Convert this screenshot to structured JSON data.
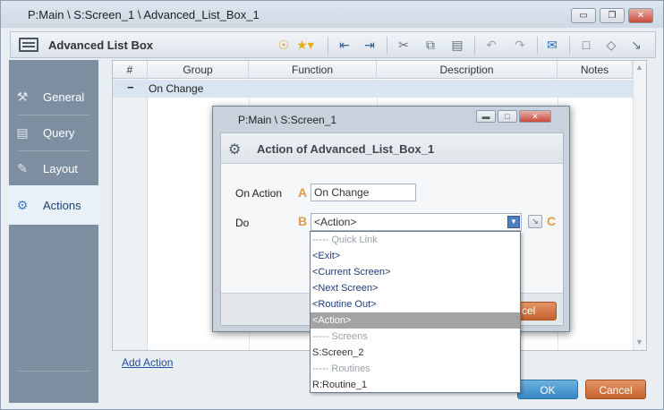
{
  "window": {
    "title": "P:Main \\ S:Screen_1 \\ Advanced_List_Box_1",
    "minimize": "▭",
    "maximize": "❐",
    "close": "✕"
  },
  "toolbar": {
    "title": "Advanced List Box",
    "icons": [
      "bulb-icon",
      "star-icon",
      "outdent-icon",
      "indent-icon",
      "cut-icon",
      "copy-icon",
      "paste-icon",
      "undo-icon",
      "redo-icon",
      "comment-icon",
      "note-icon",
      "tag-icon",
      "expand-icon"
    ]
  },
  "sidebar": {
    "items": [
      {
        "label": "General",
        "icon": "wrench-icon"
      },
      {
        "label": "Query",
        "icon": "query-icon"
      },
      {
        "label": "Layout",
        "icon": "layout-icon"
      },
      {
        "label": "Actions",
        "icon": "gears-icon",
        "active": true
      }
    ]
  },
  "grid": {
    "columns": [
      "#",
      "Group",
      "Function",
      "Description",
      "Notes"
    ],
    "group_row": {
      "toggle": "−",
      "name": "On Change"
    }
  },
  "add_action_label": "Add Action",
  "buttons": {
    "ok": "OK",
    "cancel": "Cancel"
  },
  "modal": {
    "title": "P:Main \\ S:Screen_1",
    "header": "Action of Advanced_List_Box_1",
    "on_action_label": "On Action",
    "on_action_letter": "A",
    "on_action_value": "On Change",
    "do_label": "Do",
    "do_letter": "B",
    "do_value": "<Action>",
    "c_letter": "C",
    "cancel_partial": "cel"
  },
  "dropdown": {
    "items": [
      {
        "text": "----- Quick Link",
        "kind": "sep"
      },
      {
        "text": "<Exit>",
        "kind": "link"
      },
      {
        "text": "<Current Screen>",
        "kind": "link"
      },
      {
        "text": "<Next Screen>",
        "kind": "link"
      },
      {
        "text": "<Routine Out>",
        "kind": "link"
      },
      {
        "text": "<Action>",
        "kind": "selected"
      },
      {
        "text": "----- Screens",
        "kind": "sep"
      },
      {
        "text": "S:Screen_2",
        "kind": "plain"
      },
      {
        "text": "----- Routines",
        "kind": "sep"
      },
      {
        "text": "R:Routine_1",
        "kind": "plain"
      }
    ]
  }
}
